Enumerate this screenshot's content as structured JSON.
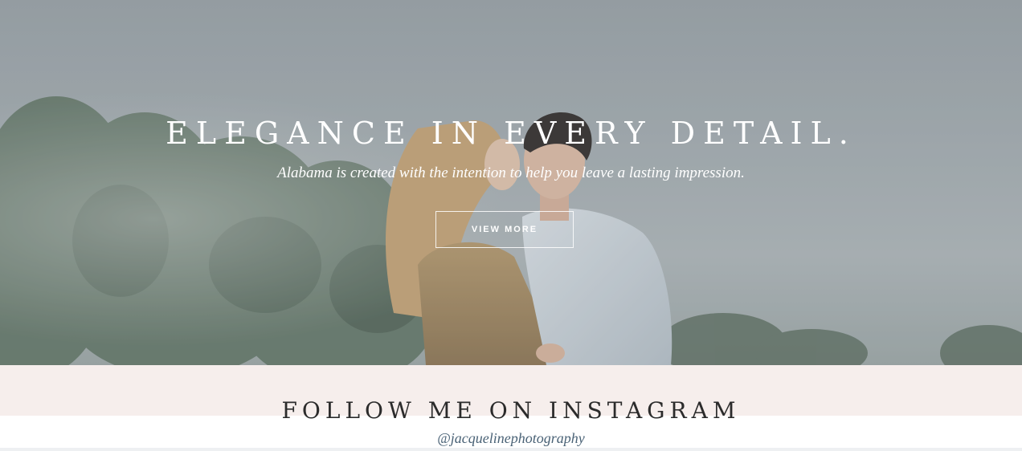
{
  "hero": {
    "title": "ELEGANCE IN EVERY DETAIL.",
    "subtitle": "Alabama is created with the intention to help you leave a lasting impression.",
    "button_label": "VIEW MORE"
  },
  "instagram": {
    "heading": "FOLLOW ME ON INSTAGRAM",
    "handle": "@jacquelinephotography"
  },
  "colors": {
    "band_background": "#f6eeec",
    "handle_text": "#4a6276",
    "heading_text": "#2b2b2b"
  }
}
